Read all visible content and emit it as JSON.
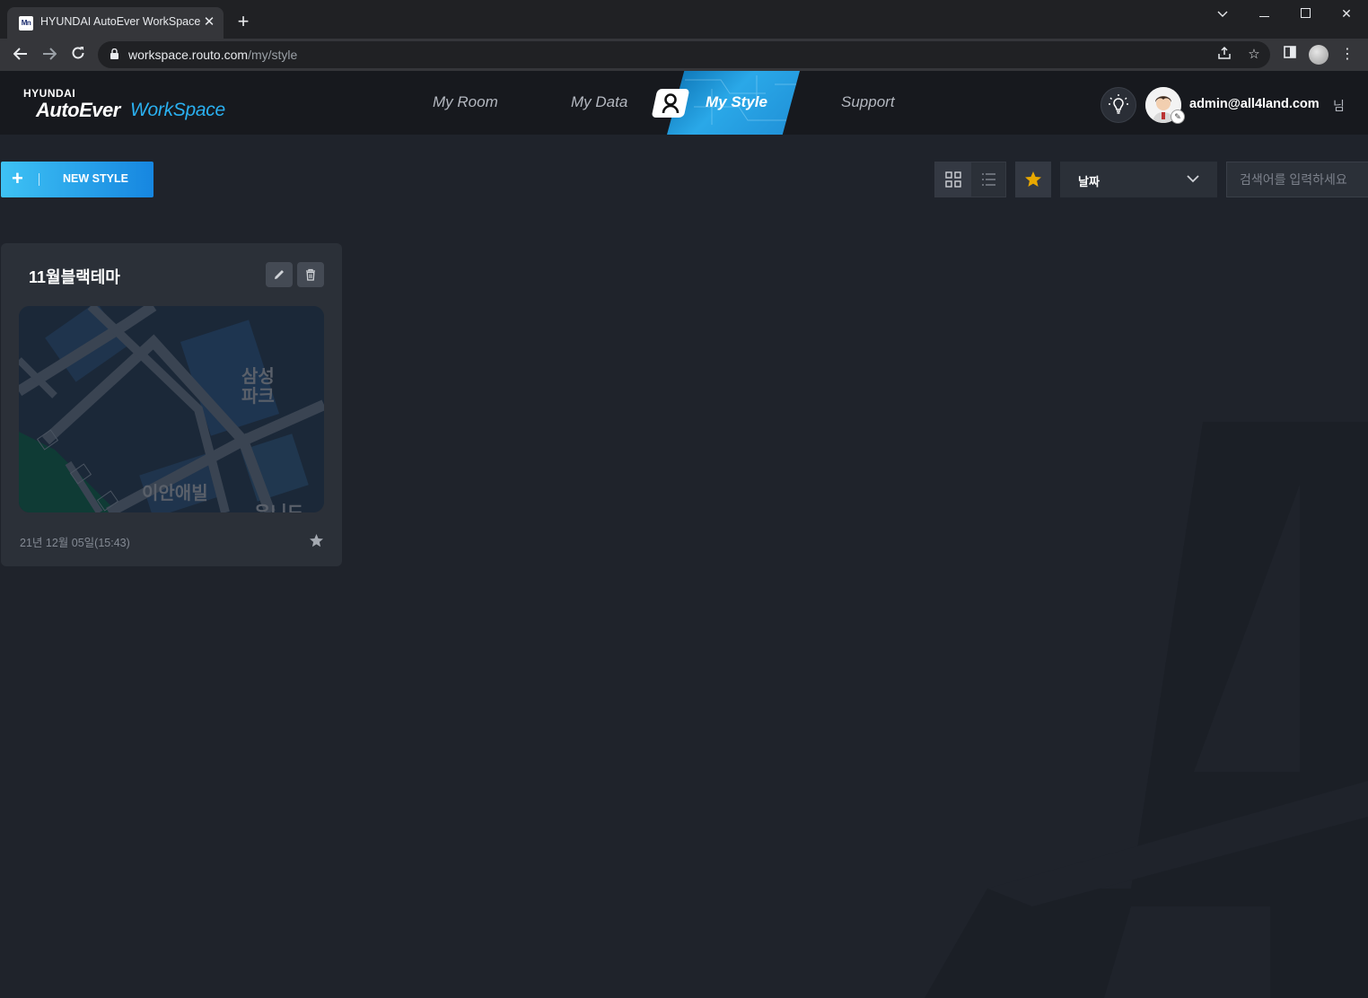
{
  "browser": {
    "tab_title": "HYUNDAI AutoEver WorkSpace",
    "favicon_text": "Mn",
    "url_host": "workspace.routo.com",
    "url_path": "/my/style"
  },
  "header": {
    "logo_top": "HYUNDAI",
    "logo_auto": "AutoEver",
    "logo_work": "WorkSpace",
    "nav": [
      "My Room",
      "My Data",
      "My Style",
      "Support"
    ],
    "active_nav": "My Style",
    "user_email": "admin@all4land.com",
    "user_suffix": "님"
  },
  "toolbar": {
    "new_style_label": "NEW STYLE",
    "sort_value": "날짜",
    "search_placeholder": "검색어를 입력하세요"
  },
  "cards": [
    {
      "title": "11월블랙테마",
      "date": "21년 12월 05일(15:43)",
      "map_labels": [
        "삼성\n파크",
        "이안애빌",
        "유니드"
      ]
    }
  ],
  "colors": {
    "accent": "#2ab0f0",
    "background": "#1f232b",
    "header_bg": "#17191e",
    "card_bg": "#2b3038",
    "favorite": "#e8a800"
  }
}
